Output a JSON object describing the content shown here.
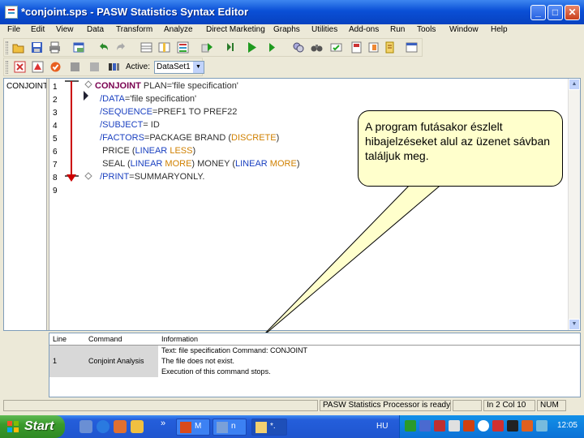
{
  "window": {
    "title": "*conjoint.sps - PASW Statistics Syntax Editor",
    "minimize": "_",
    "maximize": "□",
    "close": "✕"
  },
  "menu": [
    "File",
    "Edit",
    "View",
    "Data",
    "Transform",
    "Analyze",
    "Direct Marketing",
    "Graphs",
    "Utilities",
    "Add-ons",
    "Run",
    "Tools",
    "Window",
    "Help"
  ],
  "toolbar2": {
    "active_label": "Active:",
    "dataset": "DataSet1"
  },
  "navigator": {
    "item": "CONJOINT"
  },
  "editor": {
    "line_numbers": [
      "1",
      "2",
      "3",
      "4",
      "5",
      "6",
      "7",
      "8",
      "9"
    ],
    "lines": [
      {
        "parts": [
          {
            "cls": "kw",
            "t": "CONJOINT"
          },
          {
            "cls": "txt",
            "t": " PLAN='file specification'"
          }
        ]
      },
      {
        "parts": [
          {
            "cls": "sub",
            "t": "  /DATA"
          },
          {
            "cls": "txt",
            "t": "='file specification'"
          }
        ]
      },
      {
        "parts": [
          {
            "cls": "sub",
            "t": "  /SEQUENCE"
          },
          {
            "cls": "txt",
            "t": "=PREF1 TO PREF22"
          }
        ]
      },
      {
        "parts": [
          {
            "cls": "sub",
            "t": "  /SUBJECT"
          },
          {
            "cls": "txt",
            "t": "= ID"
          }
        ]
      },
      {
        "parts": [
          {
            "cls": "sub",
            "t": "  /FACTORS"
          },
          {
            "cls": "txt",
            "t": "=PACKAGE BRAND ("
          },
          {
            "cls": "opt",
            "t": "DISCRETE"
          },
          {
            "cls": "txt",
            "t": ")"
          }
        ]
      },
      {
        "parts": [
          {
            "cls": "txt",
            "t": "   PRICE ("
          },
          {
            "cls": "sub",
            "t": "LINEAR"
          },
          {
            "cls": "opt",
            "t": " LESS"
          },
          {
            "cls": "txt",
            "t": ")"
          }
        ]
      },
      {
        "parts": [
          {
            "cls": "txt",
            "t": "   SEAL ("
          },
          {
            "cls": "sub",
            "t": "LINEAR"
          },
          {
            "cls": "opt",
            "t": " MORE"
          },
          {
            "cls": "txt",
            "t": ") MONEY ("
          },
          {
            "cls": "sub",
            "t": "LINEAR"
          },
          {
            "cls": "opt",
            "t": " MORE"
          },
          {
            "cls": "txt",
            "t": ")"
          }
        ]
      },
      {
        "parts": [
          {
            "cls": "sub",
            "t": "  /PRINT"
          },
          {
            "cls": "txt",
            "t": "=SUMMARYONLY."
          }
        ]
      },
      {
        "parts": []
      }
    ]
  },
  "callout": {
    "text": "A program futásakor észlelt hibajelzéseket alul az üzenet sávban találjuk meg."
  },
  "messages": {
    "headers": [
      "Line",
      "Command",
      "Information"
    ],
    "rows": [
      {
        "line": "",
        "command": "",
        "info": "Text: file specification Command: CONJOINT"
      },
      {
        "line": "1",
        "command": "Conjoint Analysis",
        "info": "The file does not exist."
      },
      {
        "line": "",
        "command": "",
        "info": "Execution of this command stops."
      }
    ]
  },
  "status": {
    "processor": "PASW Statistics Processor is ready",
    "position": "In 2 Col 10",
    "num": "NUM"
  },
  "taskbar": {
    "start": "Start",
    "tasks": [
      "M",
      "n",
      "*."
    ],
    "language": "HU",
    "clock": "12:05"
  },
  "colors": {
    "title_bar": "#0a4fd6",
    "callout_bg": "#ffffcc",
    "keyword": "#7a0050",
    "subcommand": "#1a40c0",
    "option": "#d08000",
    "error_marker": "#cc0000"
  }
}
